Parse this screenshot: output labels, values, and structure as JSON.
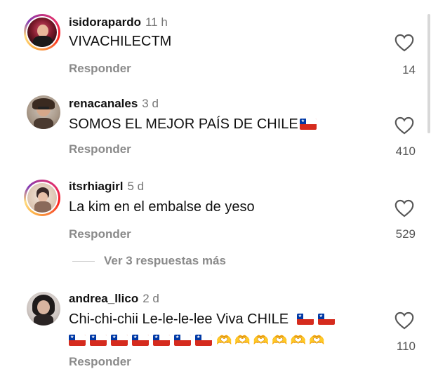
{
  "comments": [
    {
      "username": "isidorapardo",
      "time": "11 h",
      "text": "VIVACHILECTM",
      "reply_label": "Responder",
      "likes": "14",
      "ring": true
    },
    {
      "username": "renacanales",
      "time": "3 d",
      "text": "SOMOS EL MEJOR PAÍS DE CHILE",
      "reply_label": "Responder",
      "likes": "410",
      "ring": false
    },
    {
      "username": "itsrhiagirl",
      "time": "5 d",
      "text": "La kim en el embalse de yeso",
      "reply_label": "Responder",
      "likes": "529",
      "ring": true,
      "more_replies": "Ver 3 respuestas más"
    },
    {
      "username": "andrea_llico",
      "time": "2 d",
      "text": "Chi-chi-chii Le-le-le-lee Viva CHILE",
      "reply_label": "Responder",
      "likes": "110",
      "ring": false
    }
  ],
  "icons": {
    "like": "heart-outline-icon",
    "flag": "chile-flag-emoji",
    "hands": "heart-hands-emoji"
  },
  "colors": {
    "text": "#111111",
    "muted": "#8a8a8a",
    "ring_gradient": [
      "#833ab4",
      "#fd1d1d",
      "#fcaf45"
    ]
  }
}
